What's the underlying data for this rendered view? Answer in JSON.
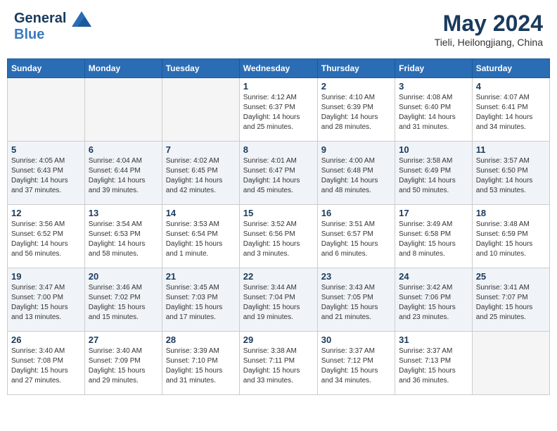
{
  "header": {
    "logo_line1": "General",
    "logo_line2": "Blue",
    "month": "May 2024",
    "location": "Tieli, Heilongjiang, China"
  },
  "weekdays": [
    "Sunday",
    "Monday",
    "Tuesday",
    "Wednesday",
    "Thursday",
    "Friday",
    "Saturday"
  ],
  "weeks": [
    [
      {
        "day": "",
        "info": ""
      },
      {
        "day": "",
        "info": ""
      },
      {
        "day": "",
        "info": ""
      },
      {
        "day": "1",
        "info": "Sunrise: 4:12 AM\nSunset: 6:37 PM\nDaylight: 14 hours\nand 25 minutes."
      },
      {
        "day": "2",
        "info": "Sunrise: 4:10 AM\nSunset: 6:39 PM\nDaylight: 14 hours\nand 28 minutes."
      },
      {
        "day": "3",
        "info": "Sunrise: 4:08 AM\nSunset: 6:40 PM\nDaylight: 14 hours\nand 31 minutes."
      },
      {
        "day": "4",
        "info": "Sunrise: 4:07 AM\nSunset: 6:41 PM\nDaylight: 14 hours\nand 34 minutes."
      }
    ],
    [
      {
        "day": "5",
        "info": "Sunrise: 4:05 AM\nSunset: 6:43 PM\nDaylight: 14 hours\nand 37 minutes."
      },
      {
        "day": "6",
        "info": "Sunrise: 4:04 AM\nSunset: 6:44 PM\nDaylight: 14 hours\nand 39 minutes."
      },
      {
        "day": "7",
        "info": "Sunrise: 4:02 AM\nSunset: 6:45 PM\nDaylight: 14 hours\nand 42 minutes."
      },
      {
        "day": "8",
        "info": "Sunrise: 4:01 AM\nSunset: 6:47 PM\nDaylight: 14 hours\nand 45 minutes."
      },
      {
        "day": "9",
        "info": "Sunrise: 4:00 AM\nSunset: 6:48 PM\nDaylight: 14 hours\nand 48 minutes."
      },
      {
        "day": "10",
        "info": "Sunrise: 3:58 AM\nSunset: 6:49 PM\nDaylight: 14 hours\nand 50 minutes."
      },
      {
        "day": "11",
        "info": "Sunrise: 3:57 AM\nSunset: 6:50 PM\nDaylight: 14 hours\nand 53 minutes."
      }
    ],
    [
      {
        "day": "12",
        "info": "Sunrise: 3:56 AM\nSunset: 6:52 PM\nDaylight: 14 hours\nand 56 minutes."
      },
      {
        "day": "13",
        "info": "Sunrise: 3:54 AM\nSunset: 6:53 PM\nDaylight: 14 hours\nand 58 minutes."
      },
      {
        "day": "14",
        "info": "Sunrise: 3:53 AM\nSunset: 6:54 PM\nDaylight: 15 hours\nand 1 minute."
      },
      {
        "day": "15",
        "info": "Sunrise: 3:52 AM\nSunset: 6:56 PM\nDaylight: 15 hours\nand 3 minutes."
      },
      {
        "day": "16",
        "info": "Sunrise: 3:51 AM\nSunset: 6:57 PM\nDaylight: 15 hours\nand 6 minutes."
      },
      {
        "day": "17",
        "info": "Sunrise: 3:49 AM\nSunset: 6:58 PM\nDaylight: 15 hours\nand 8 minutes."
      },
      {
        "day": "18",
        "info": "Sunrise: 3:48 AM\nSunset: 6:59 PM\nDaylight: 15 hours\nand 10 minutes."
      }
    ],
    [
      {
        "day": "19",
        "info": "Sunrise: 3:47 AM\nSunset: 7:00 PM\nDaylight: 15 hours\nand 13 minutes."
      },
      {
        "day": "20",
        "info": "Sunrise: 3:46 AM\nSunset: 7:02 PM\nDaylight: 15 hours\nand 15 minutes."
      },
      {
        "day": "21",
        "info": "Sunrise: 3:45 AM\nSunset: 7:03 PM\nDaylight: 15 hours\nand 17 minutes."
      },
      {
        "day": "22",
        "info": "Sunrise: 3:44 AM\nSunset: 7:04 PM\nDaylight: 15 hours\nand 19 minutes."
      },
      {
        "day": "23",
        "info": "Sunrise: 3:43 AM\nSunset: 7:05 PM\nDaylight: 15 hours\nand 21 minutes."
      },
      {
        "day": "24",
        "info": "Sunrise: 3:42 AM\nSunset: 7:06 PM\nDaylight: 15 hours\nand 23 minutes."
      },
      {
        "day": "25",
        "info": "Sunrise: 3:41 AM\nSunset: 7:07 PM\nDaylight: 15 hours\nand 25 minutes."
      }
    ],
    [
      {
        "day": "26",
        "info": "Sunrise: 3:40 AM\nSunset: 7:08 PM\nDaylight: 15 hours\nand 27 minutes."
      },
      {
        "day": "27",
        "info": "Sunrise: 3:40 AM\nSunset: 7:09 PM\nDaylight: 15 hours\nand 29 minutes."
      },
      {
        "day": "28",
        "info": "Sunrise: 3:39 AM\nSunset: 7:10 PM\nDaylight: 15 hours\nand 31 minutes."
      },
      {
        "day": "29",
        "info": "Sunrise: 3:38 AM\nSunset: 7:11 PM\nDaylight: 15 hours\nand 33 minutes."
      },
      {
        "day": "30",
        "info": "Sunrise: 3:37 AM\nSunset: 7:12 PM\nDaylight: 15 hours\nand 34 minutes."
      },
      {
        "day": "31",
        "info": "Sunrise: 3:37 AM\nSunset: 7:13 PM\nDaylight: 15 hours\nand 36 minutes."
      },
      {
        "day": "",
        "info": ""
      }
    ]
  ]
}
